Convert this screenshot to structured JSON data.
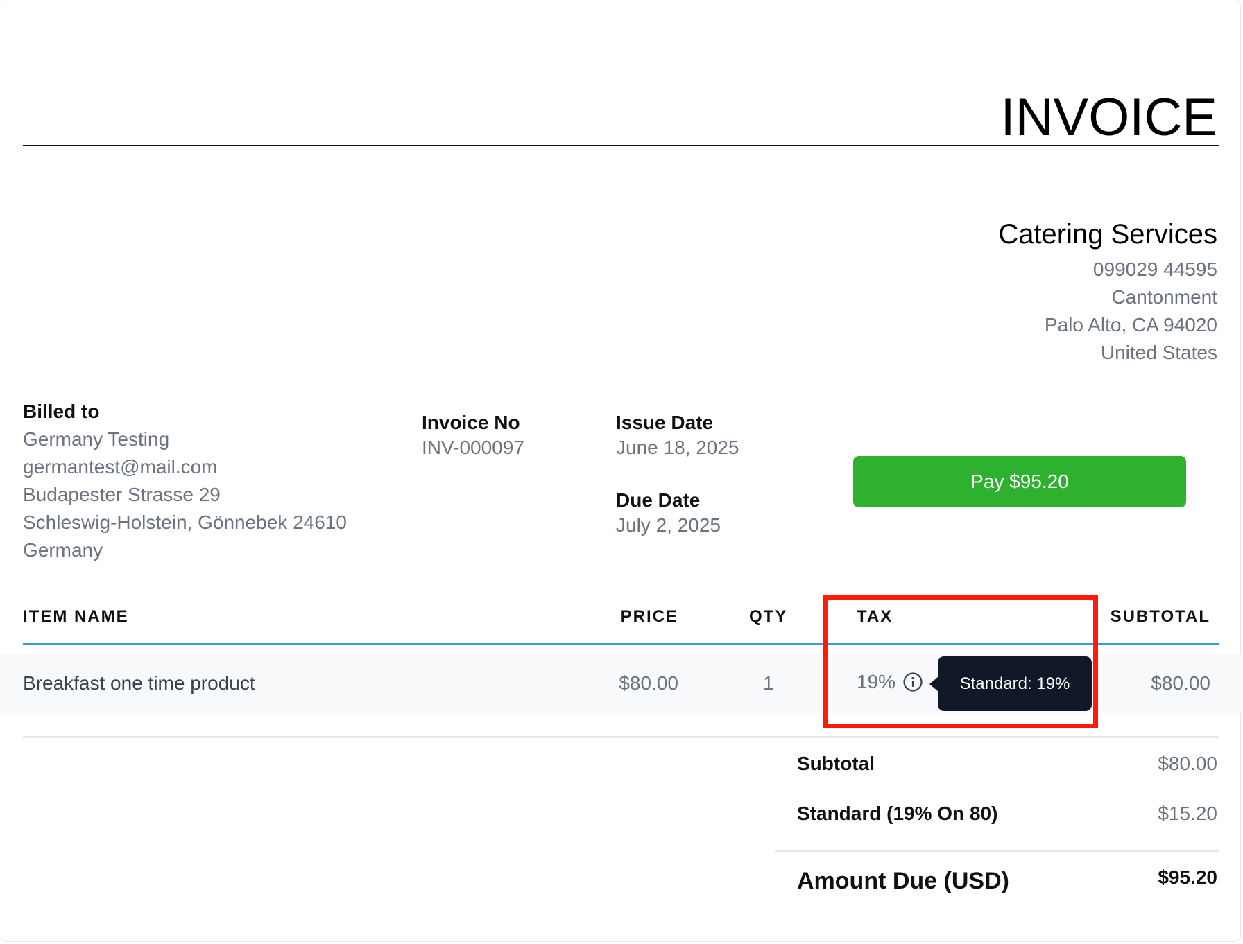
{
  "invoice": {
    "title": "INVOICE"
  },
  "company": {
    "name": "Catering Services",
    "phone": "099029 44595",
    "address_line1": "Cantonment",
    "address_line2": "Palo Alto, CA 94020",
    "country": "United States"
  },
  "billed_to": {
    "label": "Billed to",
    "name": "Germany Testing",
    "email": "germantest@mail.com",
    "street": "Budapester Strasse 29",
    "region": "Schleswig-Holstein, Gönnebek 24610",
    "country": "Germany"
  },
  "meta": {
    "invoice_no_label": "Invoice No",
    "invoice_no": "INV-000097",
    "issue_date_label": "Issue Date",
    "issue_date": "June 18, 2025",
    "due_date_label": "Due Date",
    "due_date": "July 2, 2025"
  },
  "pay_button": {
    "label": "Pay $95.20",
    "color": "#2eb12e"
  },
  "table": {
    "headers": {
      "item": "ITEM NAME",
      "price": "PRICE",
      "qty": "QTY",
      "tax": "TAX",
      "subtotal": "SUBTOTAL"
    },
    "rows": [
      {
        "item": "Breakfast one time product",
        "price": "$80.00",
        "qty": "1",
        "tax": "19%",
        "subtotal": "$80.00"
      }
    ]
  },
  "tooltip": {
    "text": "Standard: 19%",
    "icon": "info-icon"
  },
  "totals": {
    "subtotal_label": "Subtotal",
    "subtotal": "$80.00",
    "tax_label": "Standard (19% On 80)",
    "tax": "$15.20",
    "amount_due_label": "Amount Due (USD)",
    "amount_due": "$95.20"
  },
  "colors": {
    "accent_rule": "#3b9ad9",
    "highlight": "#ff1a0a",
    "tooltip_bg": "#111827"
  }
}
